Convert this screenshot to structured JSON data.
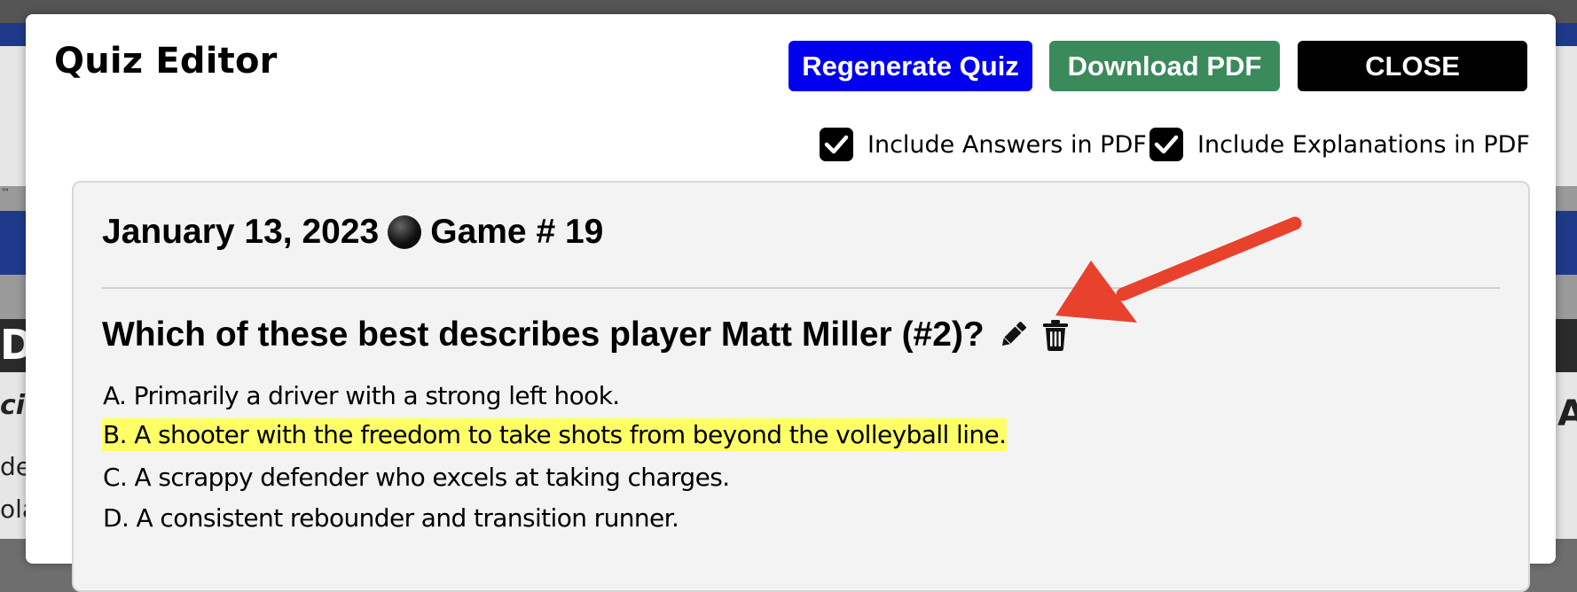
{
  "modal": {
    "title": "Quiz Editor",
    "buttons": {
      "regenerate": "Regenerate Quiz",
      "download_pdf": "Download PDF",
      "close": "CLOSE"
    },
    "options": [
      {
        "label": "Include Answers in PDF",
        "checked": true
      },
      {
        "label": "Include Explanations in PDF",
        "checked": true
      }
    ]
  },
  "quiz": {
    "date": "January 13, 2023",
    "game": "Game # 19",
    "question": "Which of these best describes player Matt Miller (#2)?",
    "answers": [
      {
        "text": "A. Primarily a driver with a strong left hook.",
        "correct": false
      },
      {
        "text": "B. A shooter with the freedom to take shots from beyond the volleyball line.",
        "correct": true
      },
      {
        "text": "C. A scrappy defender who excels at taking charges.",
        "correct": false
      },
      {
        "text": "D. A consistent rebounder and transition runner.",
        "correct": false
      }
    ],
    "icons": [
      "pencil-icon",
      "trash-icon"
    ]
  },
  "background": {
    "fragments": [
      "D",
      "ci",
      "de",
      "ola",
      "A",
      "™"
    ]
  },
  "colors": {
    "regenerate_button": "#0000ee",
    "download_button": "#3b8a5c",
    "close_button": "#000000",
    "correct_highlight": "#ffff66",
    "annotation_arrow": "#e8412c"
  }
}
